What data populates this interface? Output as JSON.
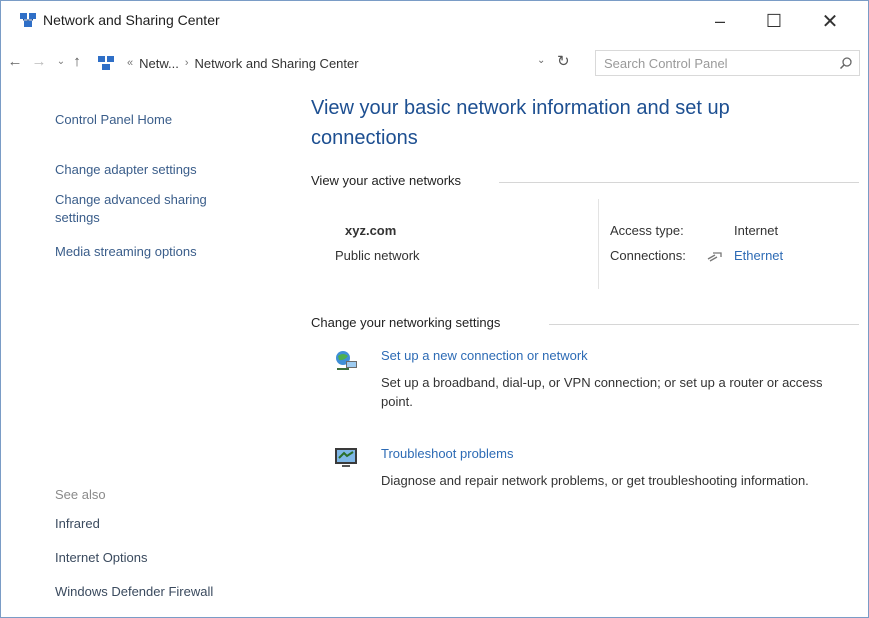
{
  "window": {
    "title": "Network and Sharing Center",
    "controls": {
      "minimize": "–",
      "maximize": "☐",
      "close": "✕"
    }
  },
  "address_bar": {
    "breadcrumbs": [
      "Netw...",
      "Network and Sharing Center"
    ],
    "search_placeholder": "Search Control Panel"
  },
  "left_pane": {
    "links": [
      "Control Panel Home",
      "Change adapter settings",
      "Change advanced sharing settings",
      "Media streaming options"
    ],
    "see_also_label": "See also",
    "see_also": [
      "Infrared",
      "Internet Options",
      "Windows Defender Firewall"
    ]
  },
  "main": {
    "heading": "View your basic network information and set up connections",
    "active_networks_label": "View your active networks",
    "network": {
      "name": "xyz.com",
      "category": "Public network",
      "access_type_label": "Access type:",
      "access_type_value": "Internet",
      "connections_label": "Connections:",
      "connections_value": "Ethernet"
    },
    "change_settings_label": "Change your networking settings",
    "tasks": [
      {
        "icon": "new-connection-icon",
        "title": "Set up a new connection or network",
        "description": "Set up a broadband, dial-up, or VPN connection; or set up a router or access point."
      },
      {
        "icon": "troubleshoot-icon",
        "title": "Troubleshoot problems",
        "description": "Diagnose and repair network problems, or get troubleshooting information."
      }
    ]
  },
  "colors": {
    "heading": "#1d4f91",
    "link": "#2d6bb5",
    "left_link": "#3a5d8a",
    "muted": "#8a8a8a"
  }
}
